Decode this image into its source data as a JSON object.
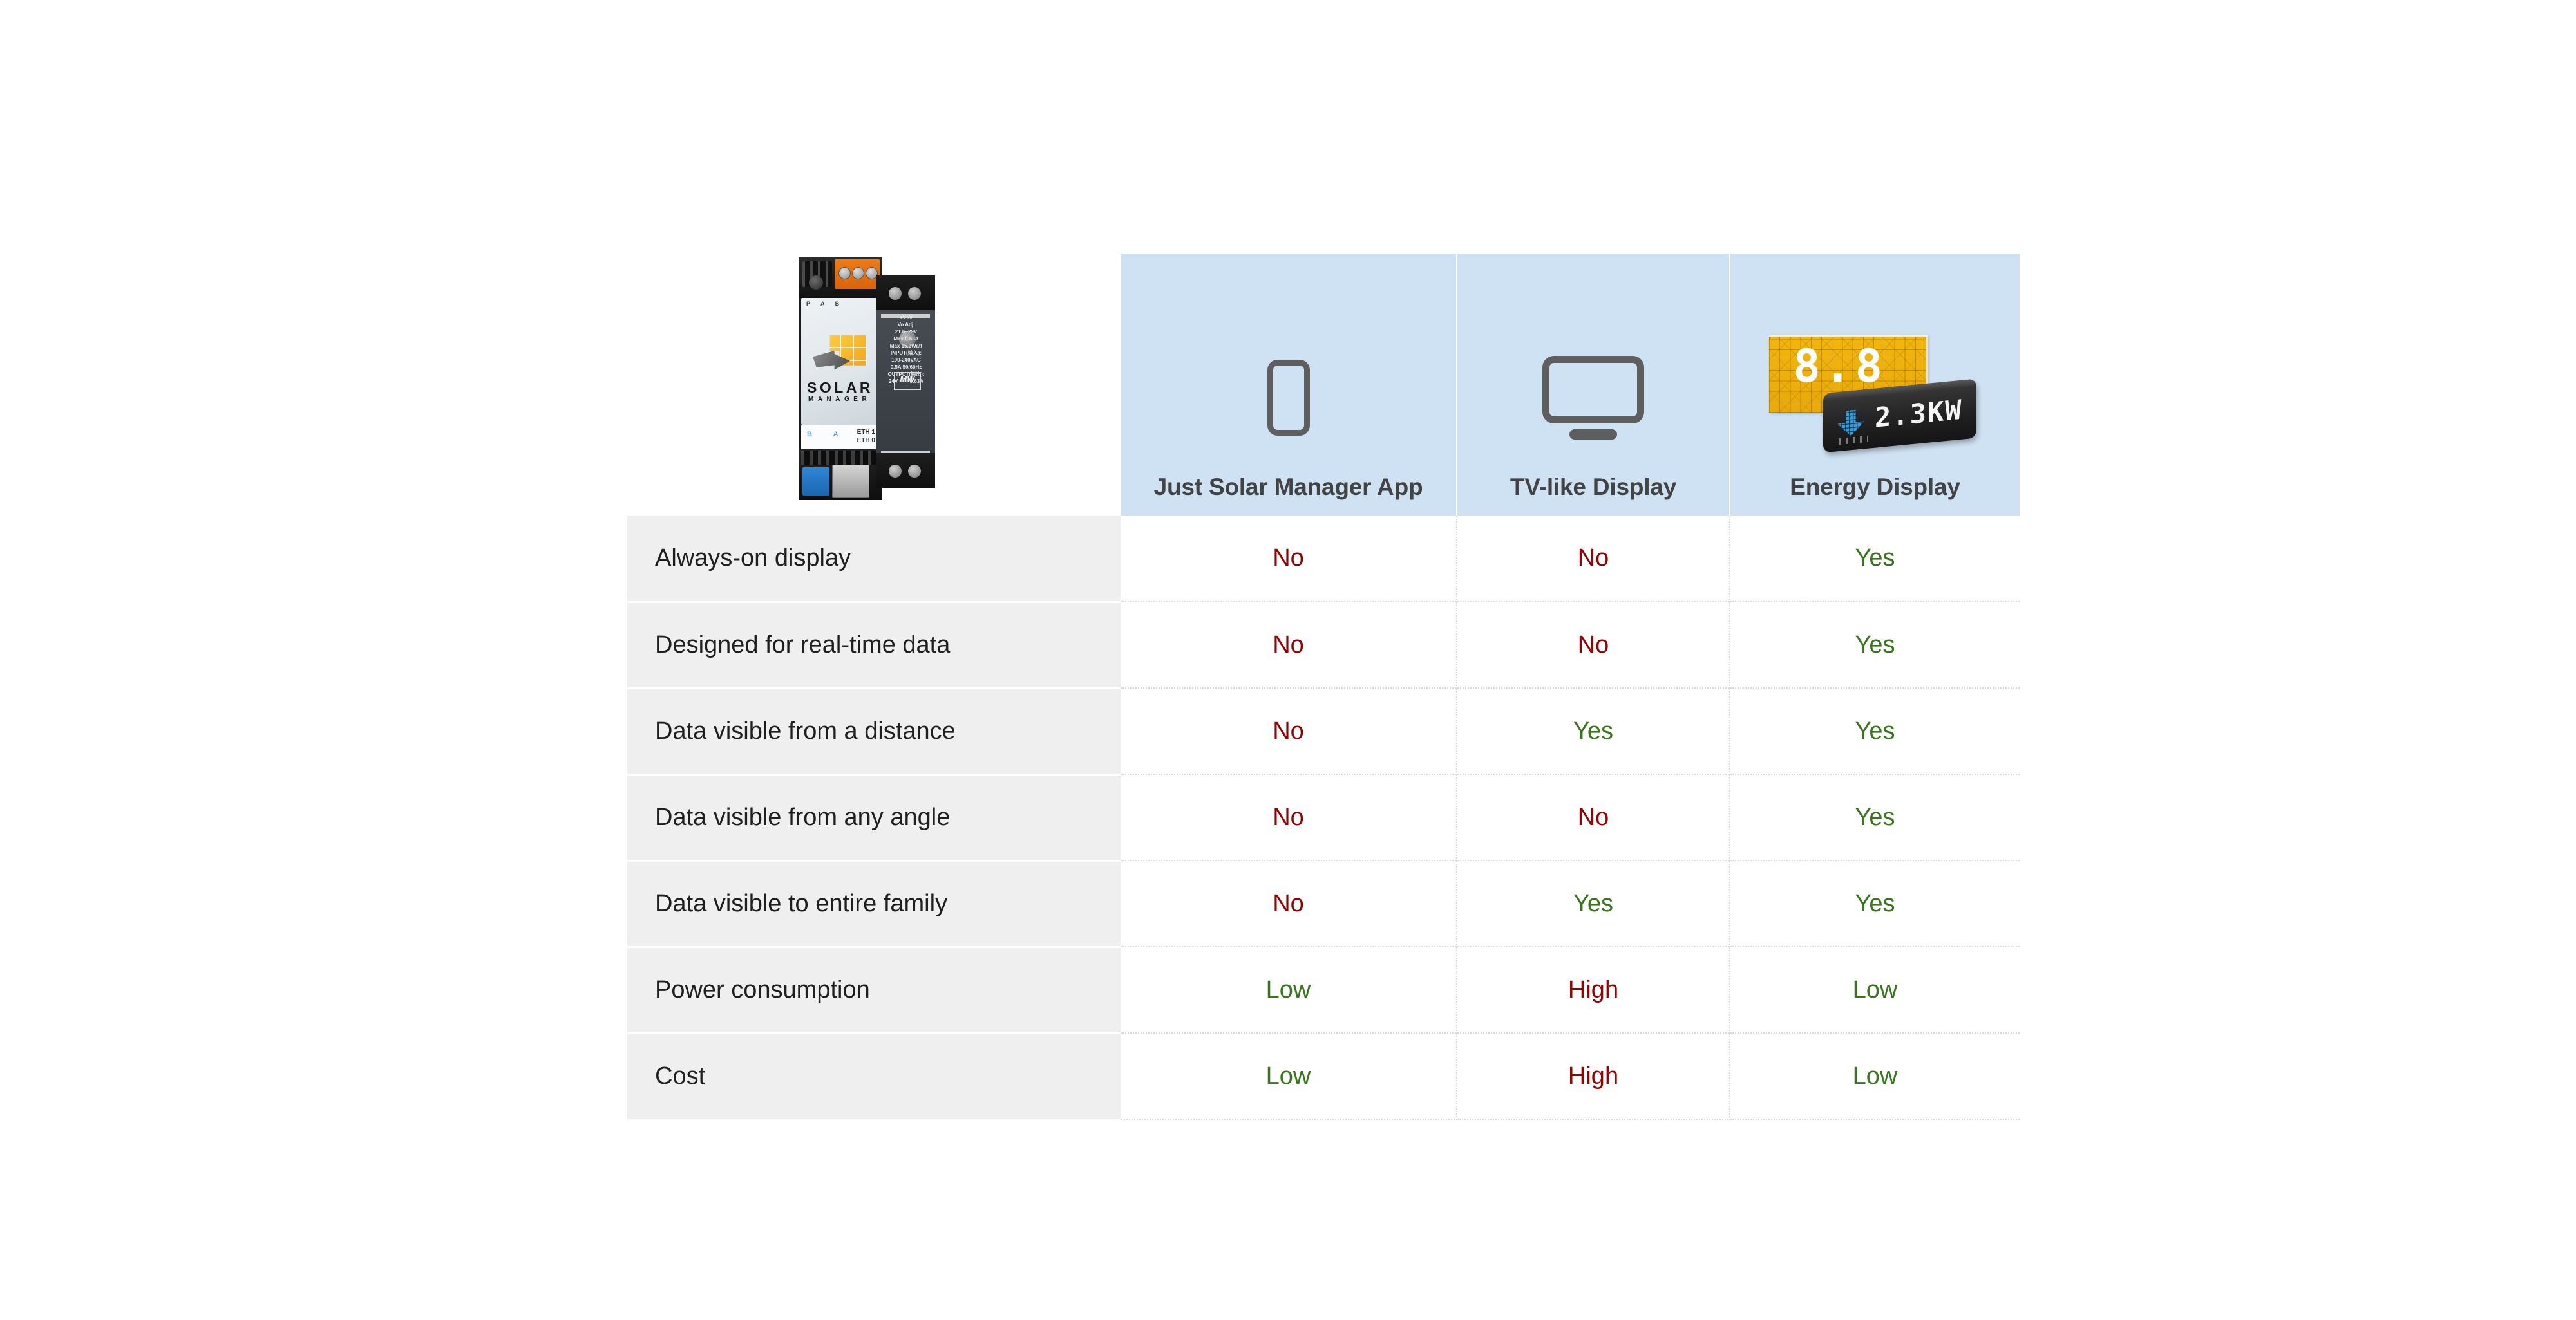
{
  "table": {
    "columns": [
      {
        "id": "product-photo",
        "label": "",
        "icon": "solar-manager-device-photo"
      },
      {
        "id": "just-solar-manager-app",
        "label": "Just Solar Manager App",
        "icon": "smartphone-icon"
      },
      {
        "id": "tv-like-display",
        "label": "TV-like Display",
        "icon": "television-icon"
      },
      {
        "id": "energy-display",
        "label": "Energy Display",
        "icon": "energy-display-icon"
      }
    ],
    "rows": [
      {
        "label": "Always-on display",
        "app": "No",
        "tv": "No",
        "energy": "Yes"
      },
      {
        "label": "Designed for real-time data",
        "app": "No",
        "tv": "No",
        "energy": "Yes"
      },
      {
        "label": "Data visible from a distance",
        "app": "No",
        "tv": "Yes",
        "energy": "Yes"
      },
      {
        "label": "Data visible from any angle",
        "app": "No",
        "tv": "No",
        "energy": "Yes"
      },
      {
        "label": "Data visible to entire family",
        "app": "No",
        "tv": "Yes",
        "energy": "Yes"
      },
      {
        "label": "Power consumption",
        "app": "Low",
        "tv": "High",
        "energy": "Low"
      },
      {
        "label": "Cost",
        "app": "Low",
        "tv": "High",
        "energy": "Low"
      }
    ]
  },
  "icons": {
    "energy_display": {
      "panel_digits": "8.8",
      "device_readout": "2.3KW",
      "arrow": "down-arrow-pixel-icon"
    },
    "product_photo": {
      "brand_wordmark": "SOLAR",
      "brand_submark": "MANAGER",
      "terminal_labels": "P  A  B",
      "port_labels_left": "B  A",
      "port_label_eth1": "ETH 1",
      "port_label_eth0": "ETH 0",
      "psu_spec_lines": "+V   -V\nVo Adj.\n21.6~29V\nMax 0.63A\nMax 15.2Watt\nINPUT(输入):\n100-240VAC\n0.5A  50/60Hz\nOUTPUT(输出):\n24V === 0.63A",
      "psu_brand": "MW",
      "psu_terminals": "N L"
    }
  },
  "colors": {
    "header_background": "#cfe2f3",
    "label_cell_background": "#efefef",
    "positive_value": "#38761d",
    "negative_value": "#990000",
    "header_text": "#434343",
    "row_label_text": "#1f1f1f",
    "grid_line": "#d9d9d9",
    "icon_gray": "#5e5e5e",
    "page_background": "#ffffff"
  }
}
